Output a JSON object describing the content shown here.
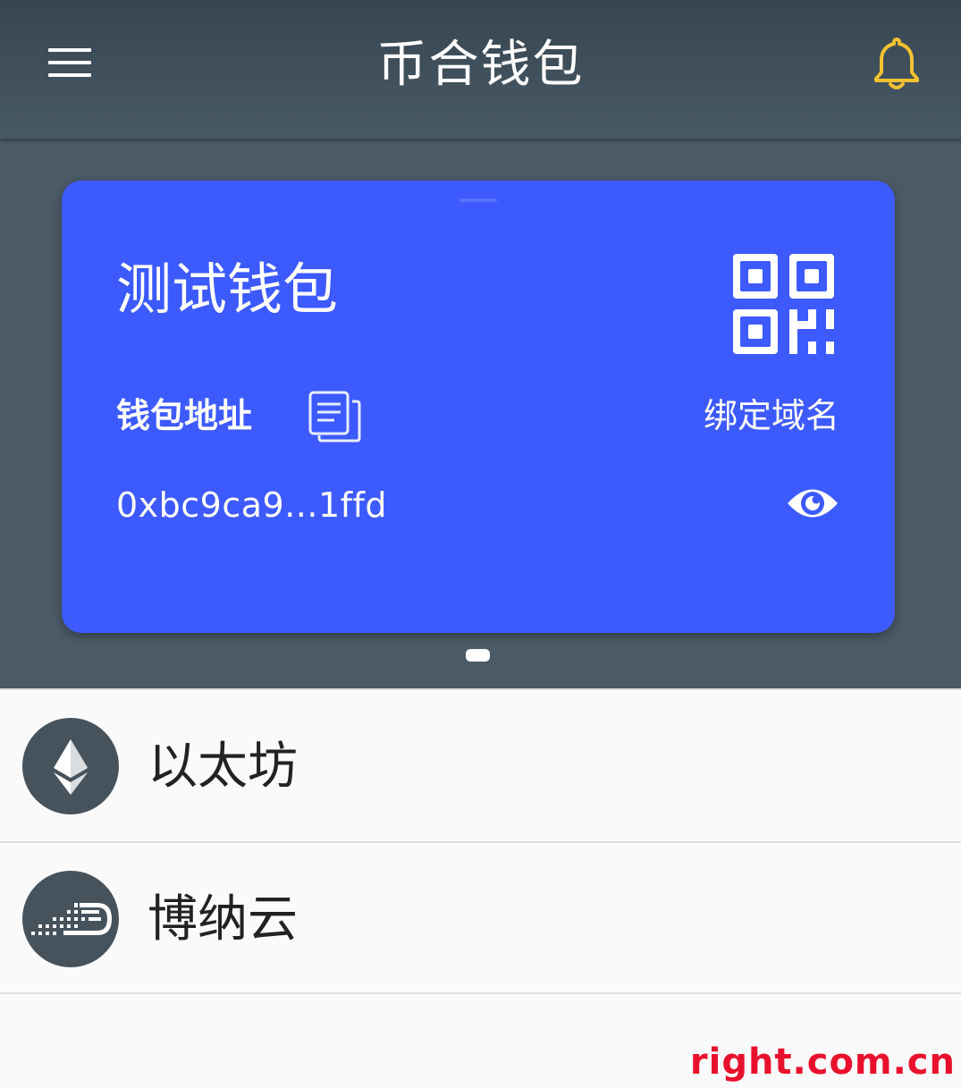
{
  "header": {
    "title": "币合钱包",
    "bell_color": "#f2c230"
  },
  "wallet_card": {
    "name": "测试钱包",
    "address_label": "钱包地址",
    "bind_domain_label": "绑定域名",
    "address": "0xbc9ca9...1ffd",
    "background_color": "#3d5afe",
    "page_count": 1
  },
  "coins": [
    {
      "name": "以太坊",
      "icon": "ethereum-icon"
    },
    {
      "name": "博纳云",
      "icon": "bonayun-icon"
    }
  ],
  "watermark": "right.com.cn"
}
